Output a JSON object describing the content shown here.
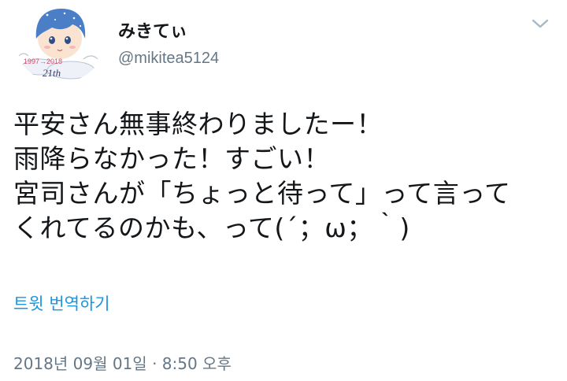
{
  "user": {
    "display_name": "みきてぃ",
    "handle": "@mikitea5124",
    "avatar": {
      "year_text": "1997→2018",
      "age_text": "21th"
    }
  },
  "tweet": {
    "text_lines": [
      "平安さん無事終わりましたー！",
      "雨降らなかった！すごい！",
      "宮司さんが「ちょっと待って」って言って",
      "くれてるのかも、って(´；ω；｀)"
    ],
    "translate_label": "트윗 번역하기",
    "timestamp": "2018년 09월 01일 · 8:50 오후"
  },
  "icons": {
    "more": "chevron-down-icon"
  },
  "colors": {
    "text": "#14171a",
    "secondary": "#657786",
    "link": "#1b95e0",
    "avatar_hair": "#4a7fc8",
    "avatar_skin": "#fbe3d2"
  }
}
